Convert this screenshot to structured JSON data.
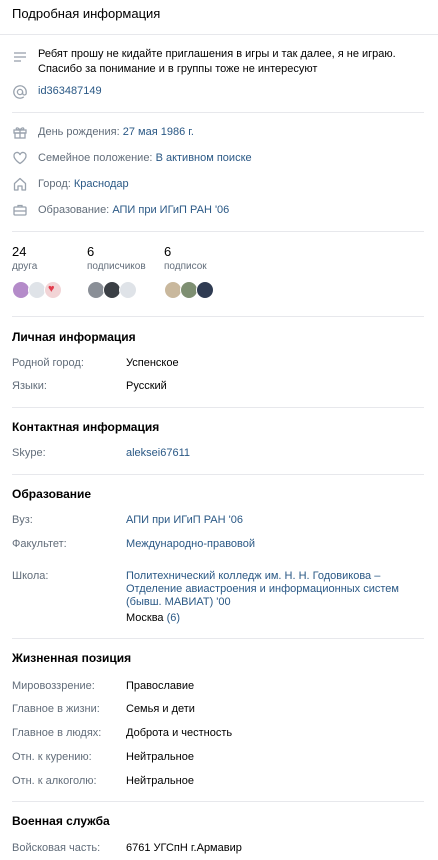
{
  "header": {
    "title": "Подробная информация"
  },
  "bio": {
    "status_text": "Ребят прошу не кидайте приглашения в игры и так далее, я не играю. Спасибо за понимание и в группы тоже не интересуют",
    "screen_name": "id363487149"
  },
  "summary": [
    {
      "label": "День рождения:",
      "value": "27 мая 1986 г."
    },
    {
      "label": "Семейное положение:",
      "value": "В активном поиске"
    },
    {
      "label": "Город:",
      "value": "Краснодар"
    },
    {
      "label": "Образование:",
      "value": "АПИ при ИГиП РАН '06"
    }
  ],
  "counters": [
    {
      "count": "24",
      "label": "друга"
    },
    {
      "count": "6",
      "label": "подписчиков"
    },
    {
      "count": "6",
      "label": "подписок"
    }
  ],
  "personal": {
    "heading": "Личная информация",
    "rows": [
      {
        "label": "Родной город:",
        "value": "Успенское"
      },
      {
        "label": "Языки:",
        "value": "Русский"
      }
    ]
  },
  "contacts": {
    "heading": "Контактная информация",
    "rows": [
      {
        "label": "Skype:",
        "value": "aleksei67611"
      }
    ]
  },
  "education": {
    "heading": "Образование",
    "university_label": "Вуз:",
    "university_value": "АПИ при ИГиП РАН '06",
    "faculty_label": "Факультет:",
    "faculty_value": "Международно-правовой",
    "school_label": "Школа:",
    "school_lines": [
      "Политехнический колледж им. Н. Н. Годовикова –",
      "Отделение авиастроения и информационных систем",
      "(бывш. МАВИАТ) '00"
    ],
    "school_city": "Москва",
    "school_city_count": "(6)"
  },
  "life": {
    "heading": "Жизненная позиция",
    "rows": [
      {
        "label": "Мировоззрение:",
        "value": "Православие"
      },
      {
        "label": "Главное в жизни:",
        "value": "Семья и дети"
      },
      {
        "label": "Главное в людях:",
        "value": "Доброта и честность"
      },
      {
        "label": "Отн. к курению:",
        "value": "Нейтральное"
      },
      {
        "label": "Отн. к алкоголю:",
        "value": "Нейтральное"
      }
    ]
  },
  "military": {
    "heading": "Военная служба",
    "rows": [
      {
        "label": "Войсковая часть:",
        "value": "6761 УГСпН г.Армавир"
      }
    ]
  }
}
